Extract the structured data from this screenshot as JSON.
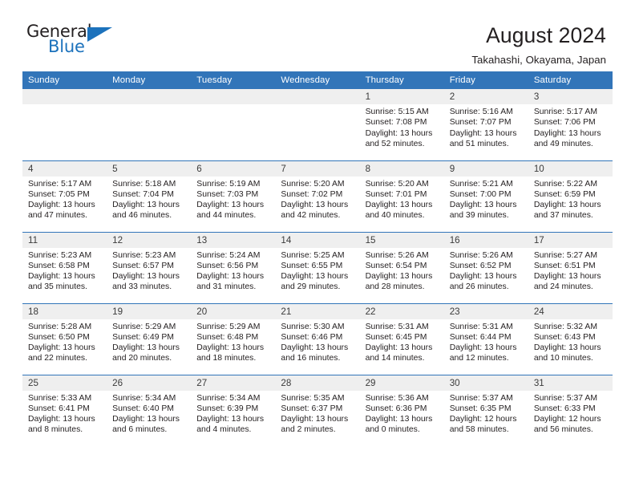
{
  "brand": {
    "name_part1": "General",
    "name_part2": "Blue",
    "triangle_color": "#1c72bc"
  },
  "header": {
    "title": "August 2024",
    "subtitle": "Takahashi, Okayama, Japan",
    "header_bg_color": "#3275b9",
    "daynum_bg_color": "#efefef"
  },
  "weekdays": [
    "Sunday",
    "Monday",
    "Tuesday",
    "Wednesday",
    "Thursday",
    "Friday",
    "Saturday"
  ],
  "weeks": [
    [
      {
        "day": "",
        "empty": true,
        "sunrise": "",
        "sunset": "",
        "daylight1": "",
        "daylight2": ""
      },
      {
        "day": "",
        "empty": true,
        "sunrise": "",
        "sunset": "",
        "daylight1": "",
        "daylight2": ""
      },
      {
        "day": "",
        "empty": true,
        "sunrise": "",
        "sunset": "",
        "daylight1": "",
        "daylight2": ""
      },
      {
        "day": "",
        "empty": true,
        "sunrise": "",
        "sunset": "",
        "daylight1": "",
        "daylight2": ""
      },
      {
        "day": "1",
        "sunrise": "Sunrise: 5:15 AM",
        "sunset": "Sunset: 7:08 PM",
        "daylight1": "Daylight: 13 hours",
        "daylight2": "and 52 minutes."
      },
      {
        "day": "2",
        "sunrise": "Sunrise: 5:16 AM",
        "sunset": "Sunset: 7:07 PM",
        "daylight1": "Daylight: 13 hours",
        "daylight2": "and 51 minutes."
      },
      {
        "day": "3",
        "sunrise": "Sunrise: 5:17 AM",
        "sunset": "Sunset: 7:06 PM",
        "daylight1": "Daylight: 13 hours",
        "daylight2": "and 49 minutes."
      }
    ],
    [
      {
        "day": "4",
        "sunrise": "Sunrise: 5:17 AM",
        "sunset": "Sunset: 7:05 PM",
        "daylight1": "Daylight: 13 hours",
        "daylight2": "and 47 minutes."
      },
      {
        "day": "5",
        "sunrise": "Sunrise: 5:18 AM",
        "sunset": "Sunset: 7:04 PM",
        "daylight1": "Daylight: 13 hours",
        "daylight2": "and 46 minutes."
      },
      {
        "day": "6",
        "sunrise": "Sunrise: 5:19 AM",
        "sunset": "Sunset: 7:03 PM",
        "daylight1": "Daylight: 13 hours",
        "daylight2": "and 44 minutes."
      },
      {
        "day": "7",
        "sunrise": "Sunrise: 5:20 AM",
        "sunset": "Sunset: 7:02 PM",
        "daylight1": "Daylight: 13 hours",
        "daylight2": "and 42 minutes."
      },
      {
        "day": "8",
        "sunrise": "Sunrise: 5:20 AM",
        "sunset": "Sunset: 7:01 PM",
        "daylight1": "Daylight: 13 hours",
        "daylight2": "and 40 minutes."
      },
      {
        "day": "9",
        "sunrise": "Sunrise: 5:21 AM",
        "sunset": "Sunset: 7:00 PM",
        "daylight1": "Daylight: 13 hours",
        "daylight2": "and 39 minutes."
      },
      {
        "day": "10",
        "sunrise": "Sunrise: 5:22 AM",
        "sunset": "Sunset: 6:59 PM",
        "daylight1": "Daylight: 13 hours",
        "daylight2": "and 37 minutes."
      }
    ],
    [
      {
        "day": "11",
        "sunrise": "Sunrise: 5:23 AM",
        "sunset": "Sunset: 6:58 PM",
        "daylight1": "Daylight: 13 hours",
        "daylight2": "and 35 minutes."
      },
      {
        "day": "12",
        "sunrise": "Sunrise: 5:23 AM",
        "sunset": "Sunset: 6:57 PM",
        "daylight1": "Daylight: 13 hours",
        "daylight2": "and 33 minutes."
      },
      {
        "day": "13",
        "sunrise": "Sunrise: 5:24 AM",
        "sunset": "Sunset: 6:56 PM",
        "daylight1": "Daylight: 13 hours",
        "daylight2": "and 31 minutes."
      },
      {
        "day": "14",
        "sunrise": "Sunrise: 5:25 AM",
        "sunset": "Sunset: 6:55 PM",
        "daylight1": "Daylight: 13 hours",
        "daylight2": "and 29 minutes."
      },
      {
        "day": "15",
        "sunrise": "Sunrise: 5:26 AM",
        "sunset": "Sunset: 6:54 PM",
        "daylight1": "Daylight: 13 hours",
        "daylight2": "and 28 minutes."
      },
      {
        "day": "16",
        "sunrise": "Sunrise: 5:26 AM",
        "sunset": "Sunset: 6:52 PM",
        "daylight1": "Daylight: 13 hours",
        "daylight2": "and 26 minutes."
      },
      {
        "day": "17",
        "sunrise": "Sunrise: 5:27 AM",
        "sunset": "Sunset: 6:51 PM",
        "daylight1": "Daylight: 13 hours",
        "daylight2": "and 24 minutes."
      }
    ],
    [
      {
        "day": "18",
        "sunrise": "Sunrise: 5:28 AM",
        "sunset": "Sunset: 6:50 PM",
        "daylight1": "Daylight: 13 hours",
        "daylight2": "and 22 minutes."
      },
      {
        "day": "19",
        "sunrise": "Sunrise: 5:29 AM",
        "sunset": "Sunset: 6:49 PM",
        "daylight1": "Daylight: 13 hours",
        "daylight2": "and 20 minutes."
      },
      {
        "day": "20",
        "sunrise": "Sunrise: 5:29 AM",
        "sunset": "Sunset: 6:48 PM",
        "daylight1": "Daylight: 13 hours",
        "daylight2": "and 18 minutes."
      },
      {
        "day": "21",
        "sunrise": "Sunrise: 5:30 AM",
        "sunset": "Sunset: 6:46 PM",
        "daylight1": "Daylight: 13 hours",
        "daylight2": "and 16 minutes."
      },
      {
        "day": "22",
        "sunrise": "Sunrise: 5:31 AM",
        "sunset": "Sunset: 6:45 PM",
        "daylight1": "Daylight: 13 hours",
        "daylight2": "and 14 minutes."
      },
      {
        "day": "23",
        "sunrise": "Sunrise: 5:31 AM",
        "sunset": "Sunset: 6:44 PM",
        "daylight1": "Daylight: 13 hours",
        "daylight2": "and 12 minutes."
      },
      {
        "day": "24",
        "sunrise": "Sunrise: 5:32 AM",
        "sunset": "Sunset: 6:43 PM",
        "daylight1": "Daylight: 13 hours",
        "daylight2": "and 10 minutes."
      }
    ],
    [
      {
        "day": "25",
        "sunrise": "Sunrise: 5:33 AM",
        "sunset": "Sunset: 6:41 PM",
        "daylight1": "Daylight: 13 hours",
        "daylight2": "and 8 minutes."
      },
      {
        "day": "26",
        "sunrise": "Sunrise: 5:34 AM",
        "sunset": "Sunset: 6:40 PM",
        "daylight1": "Daylight: 13 hours",
        "daylight2": "and 6 minutes."
      },
      {
        "day": "27",
        "sunrise": "Sunrise: 5:34 AM",
        "sunset": "Sunset: 6:39 PM",
        "daylight1": "Daylight: 13 hours",
        "daylight2": "and 4 minutes."
      },
      {
        "day": "28",
        "sunrise": "Sunrise: 5:35 AM",
        "sunset": "Sunset: 6:37 PM",
        "daylight1": "Daylight: 13 hours",
        "daylight2": "and 2 minutes."
      },
      {
        "day": "29",
        "sunrise": "Sunrise: 5:36 AM",
        "sunset": "Sunset: 6:36 PM",
        "daylight1": "Daylight: 13 hours",
        "daylight2": "and 0 minutes."
      },
      {
        "day": "30",
        "sunrise": "Sunrise: 5:37 AM",
        "sunset": "Sunset: 6:35 PM",
        "daylight1": "Daylight: 12 hours",
        "daylight2": "and 58 minutes."
      },
      {
        "day": "31",
        "sunrise": "Sunrise: 5:37 AM",
        "sunset": "Sunset: 6:33 PM",
        "daylight1": "Daylight: 12 hours",
        "daylight2": "and 56 minutes."
      }
    ]
  ]
}
